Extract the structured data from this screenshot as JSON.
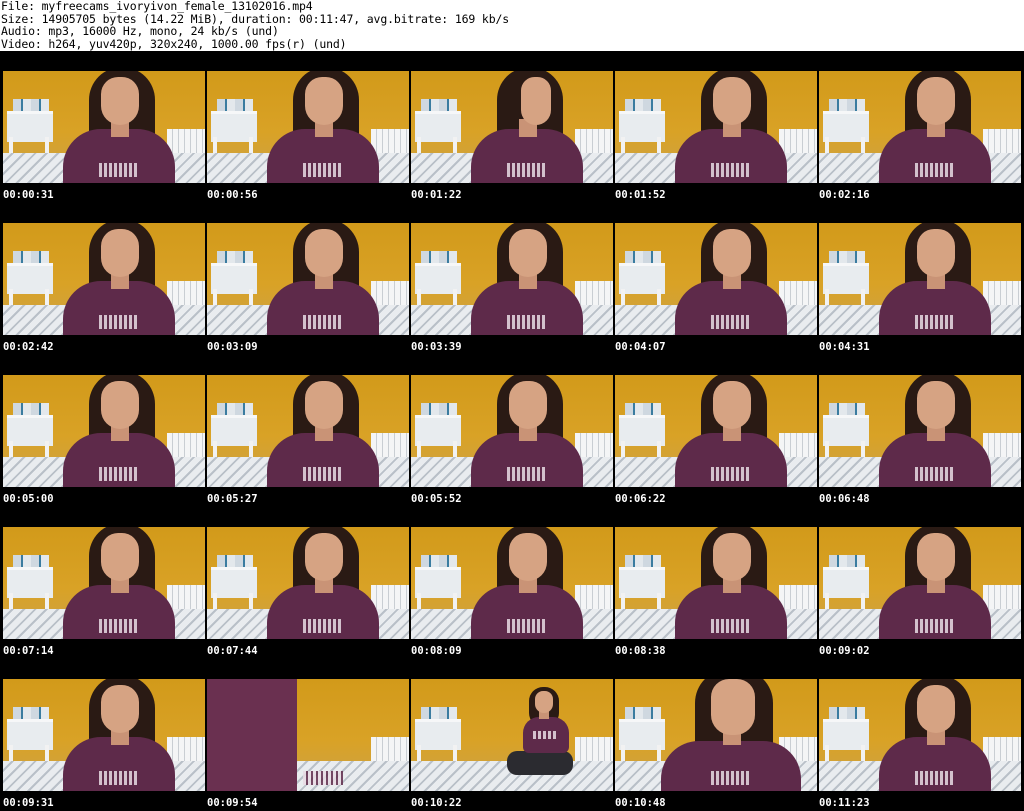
{
  "header": {
    "file_line": "File: myfreecams_ivoryivon_female_13102016.mp4",
    "size_line": "Size: 14905705 bytes (14.22 MiB), duration: 00:11:47, avg.bitrate: 169 kb/s",
    "audio_line": "Audio: mp3, 16000 Hz, mono, 24 kb/s (und)",
    "video_line": "Video: h264, yuv420p, 320x240, 1000.00 fps(r) (und)"
  },
  "colors": {
    "background": "#000000",
    "header_background": "#ffffff",
    "timestamp_text": "#ffffff",
    "wall": "#d29a1a",
    "shirt": "#5e2a4a"
  },
  "thumbnails": [
    {
      "timestamp": "00:00:31",
      "variant": "v-normal"
    },
    {
      "timestamp": "00:00:56",
      "variant": "v-normal"
    },
    {
      "timestamp": "00:01:22",
      "variant": "v-turn"
    },
    {
      "timestamp": "00:01:52",
      "variant": "v-normal"
    },
    {
      "timestamp": "00:02:16",
      "variant": "v-normal"
    },
    {
      "timestamp": "00:02:42",
      "variant": "v-normal"
    },
    {
      "timestamp": "00:03:09",
      "variant": "v-normal"
    },
    {
      "timestamp": "00:03:39",
      "variant": "v-normal"
    },
    {
      "timestamp": "00:04:07",
      "variant": "v-normal"
    },
    {
      "timestamp": "00:04:31",
      "variant": "v-normal"
    },
    {
      "timestamp": "00:05:00",
      "variant": "v-normal"
    },
    {
      "timestamp": "00:05:27",
      "variant": "v-normal"
    },
    {
      "timestamp": "00:05:52",
      "variant": "v-normal"
    },
    {
      "timestamp": "00:06:22",
      "variant": "v-normal"
    },
    {
      "timestamp": "00:06:48",
      "variant": "v-normal"
    },
    {
      "timestamp": "00:07:14",
      "variant": "v-normal"
    },
    {
      "timestamp": "00:07:44",
      "variant": "v-normal"
    },
    {
      "timestamp": "00:08:09",
      "variant": "v-normal"
    },
    {
      "timestamp": "00:08:38",
      "variant": "v-normal"
    },
    {
      "timestamp": "00:09:02",
      "variant": "v-normal"
    },
    {
      "timestamp": "00:09:31",
      "variant": "v-normal"
    },
    {
      "timestamp": "00:09:54",
      "variant": "v-torso"
    },
    {
      "timestamp": "00:10:22",
      "variant": "v-far"
    },
    {
      "timestamp": "00:10:48",
      "variant": "v-close"
    },
    {
      "timestamp": "00:11:23",
      "variant": "v-normal"
    }
  ]
}
